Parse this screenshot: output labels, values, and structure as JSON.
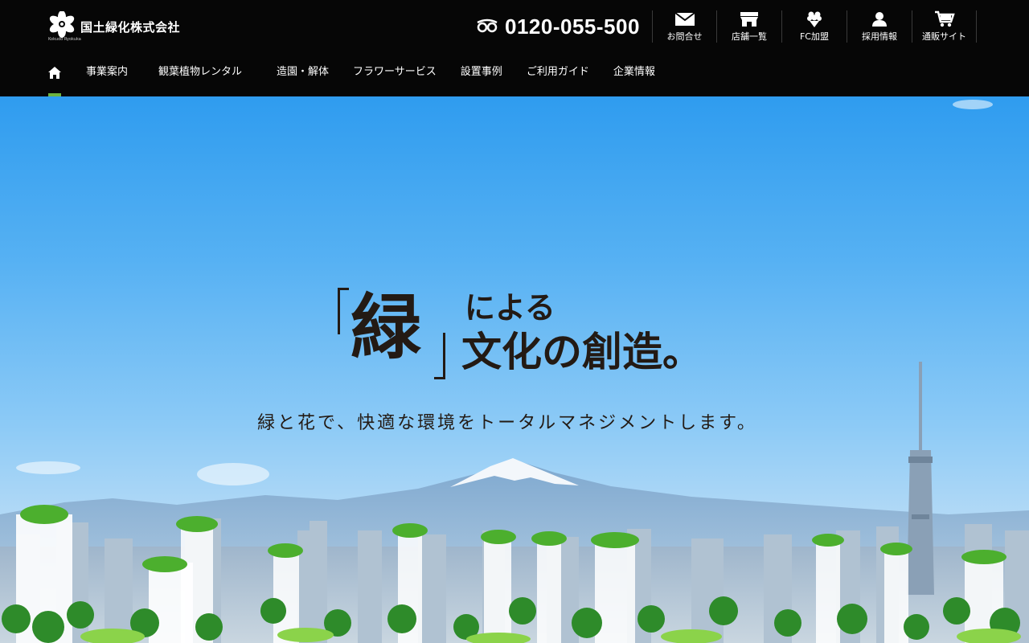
{
  "brand": {
    "name": "国土緑化株式会社",
    "sub": "Kokudo Ryokuka"
  },
  "phone": {
    "number": "0120-055-500",
    "icon": "free-dial-icon"
  },
  "utility_nav": [
    {
      "label": "お問合せ",
      "icon": "mail-icon"
    },
    {
      "label": "店舗一覧",
      "icon": "shop-icon"
    },
    {
      "label": "FC加盟",
      "icon": "flower-icon"
    },
    {
      "label": "採用情報",
      "icon": "person-icon"
    },
    {
      "label": "通販サイト",
      "icon": "cart-icon"
    }
  ],
  "main_nav": {
    "home_icon": "home-icon",
    "items": [
      "事業案内",
      "観葉植物レンタル",
      "造園・解体",
      "フラワーサービス",
      "設置事例",
      "ご利用ガイド",
      "企業情報"
    ]
  },
  "hero": {
    "headline_big": "緑",
    "headline_line1": "による",
    "headline_line2": "文化の創造。",
    "subline": "緑と花で、快適な環境をトータルマネジメントします。"
  },
  "colors": {
    "header_bg": "#060606",
    "accent": "#6db33f",
    "sky_top": "#2f9cef",
    "ink": "#231a14"
  }
}
